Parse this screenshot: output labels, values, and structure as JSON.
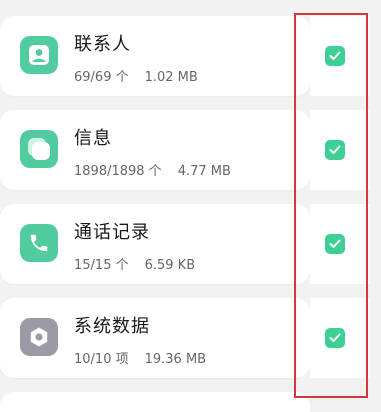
{
  "colors": {
    "accent_green": "#3ecf95",
    "icon_green": "#52cc9f",
    "settings_icon_gray": "#9b9ba6",
    "highlight_red": "#d03a3a"
  },
  "items": [
    {
      "title": "联系人",
      "count": "69/69 个",
      "size": "1.02 MB",
      "icon": "contact-icon",
      "checked": true
    },
    {
      "title": "信息",
      "count": "1898/1898 个",
      "size": "4.77 MB",
      "icon": "message-icon",
      "checked": true
    },
    {
      "title": "通话记录",
      "count": "15/15 个",
      "size": "6.59 KB",
      "icon": "phone-icon",
      "checked": true
    },
    {
      "title": "系统数据",
      "count": "10/10 项",
      "size": "19.36 MB",
      "icon": "settings-icon",
      "checked": true
    }
  ]
}
